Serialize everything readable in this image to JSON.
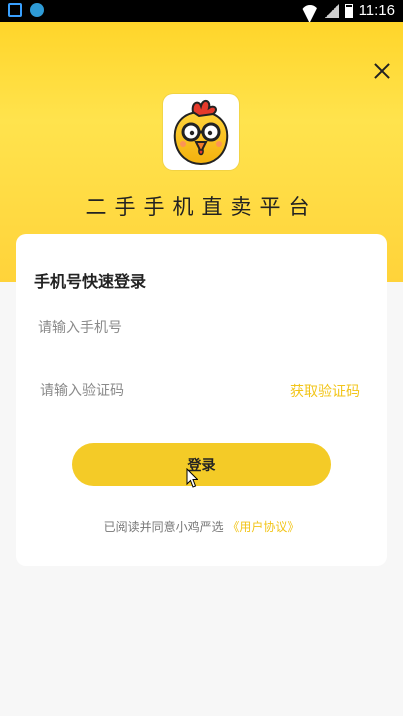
{
  "status_bar": {
    "time": "11:16"
  },
  "header": {
    "app_name": "二手手机直卖平台",
    "close_icon": "close-icon"
  },
  "login_card": {
    "title": "手机号快速登录",
    "phone_placeholder": "请输入手机号",
    "code_placeholder": "请输入验证码",
    "get_code_label": "获取验证码",
    "login_label": "登录",
    "agreement_prefix": "已阅读并同意小鸡严选",
    "agreement_link": "《用户协议》"
  },
  "colors": {
    "accent": "#f4cb27",
    "link": "#f2c51a",
    "header_bg": "#ffd52a"
  }
}
